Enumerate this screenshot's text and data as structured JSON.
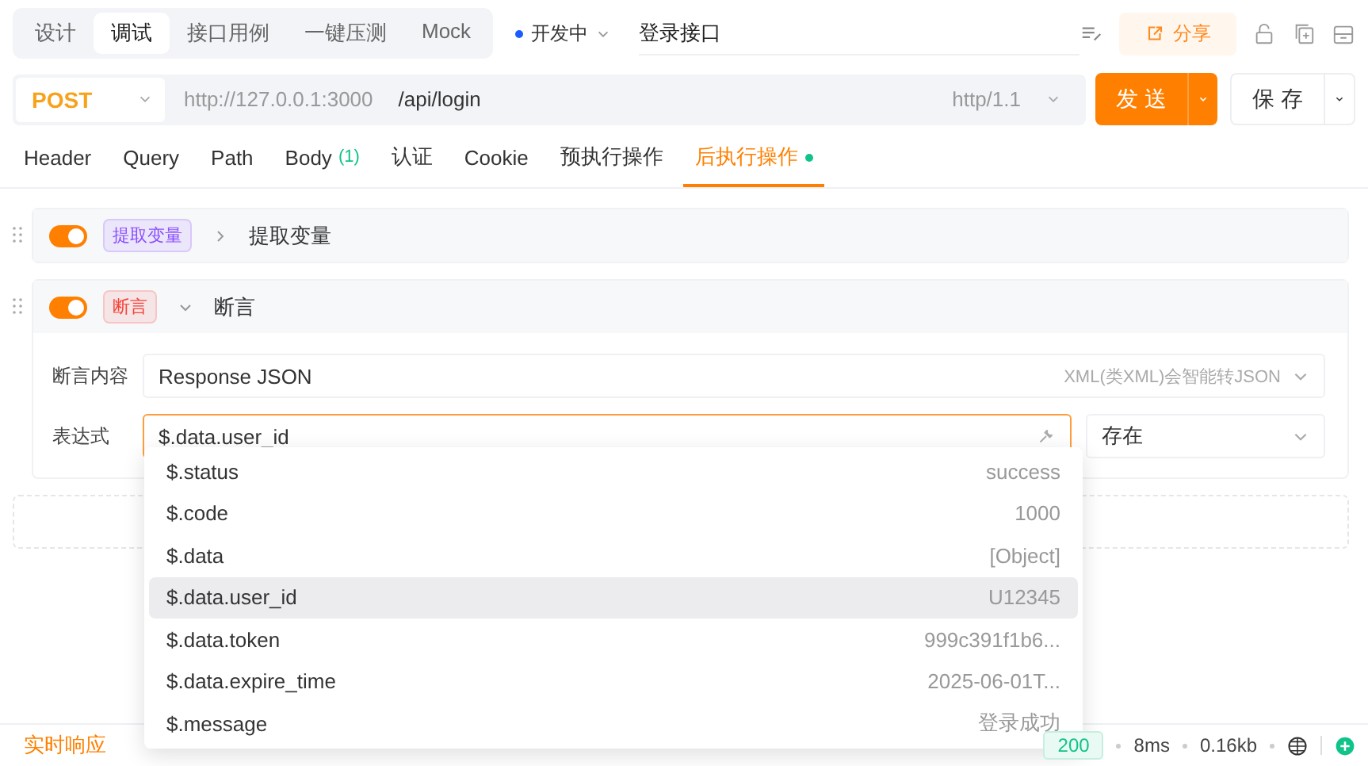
{
  "mode_tabs": [
    {
      "label": "设计",
      "selected": false
    },
    {
      "label": "调试",
      "selected": true
    },
    {
      "label": "接口用例",
      "selected": false
    },
    {
      "label": "一键压测",
      "selected": false
    },
    {
      "label": "Mock",
      "selected": false
    }
  ],
  "status": {
    "label": "开发中",
    "color": "#1a5cff"
  },
  "api_name": "登录接口",
  "share_button": "分享",
  "request": {
    "method": "POST",
    "base_url": "http://127.0.0.1:3000",
    "path": "/api/login",
    "protocol": "http/1.1",
    "send_button": "发 送",
    "save_button": "保 存"
  },
  "request_tabs": [
    {
      "label": "Header",
      "selected": false
    },
    {
      "label": "Query",
      "selected": false
    },
    {
      "label": "Path",
      "selected": false
    },
    {
      "label": "Body",
      "count": "(1)",
      "selected": false
    },
    {
      "label": "认证",
      "selected": false
    },
    {
      "label": "Cookie",
      "selected": false
    },
    {
      "label": "预执行操作",
      "selected": false
    },
    {
      "label": "后执行操作",
      "selected": true,
      "dot": true
    }
  ],
  "operations": [
    {
      "on": true,
      "tag": "提取变量",
      "color": "#8a4dff",
      "expanded": false,
      "title": "提取变量"
    },
    {
      "on": true,
      "tag": "断言",
      "color": "#f5443a",
      "expanded": true,
      "title": "断言",
      "content_label": "断言内容",
      "content_value": "Response JSON",
      "content_hint": "XML(类XML)会智能转JSON",
      "expr_label": "表达式",
      "expr_value": "$.data.user_id",
      "condition": "存在"
    }
  ],
  "suggestions": [
    {
      "path": "$.status",
      "value": "success",
      "selected": false
    },
    {
      "path": "$.code",
      "value": "1000",
      "selected": false
    },
    {
      "path": "$.data",
      "value": "[Object]",
      "selected": false
    },
    {
      "path": "$.data.user_id",
      "value": "U12345",
      "selected": true
    },
    {
      "path": "$.data.token",
      "value": "999c391f1b6...",
      "selected": false
    },
    {
      "path": "$.data.expire_time",
      "value": "2025-06-01T...",
      "selected": false
    },
    {
      "path": "$.message",
      "value": "登录成功",
      "selected": false
    }
  ],
  "response_bar": {
    "tab": "实时响应",
    "status_code": "200",
    "time": "8ms",
    "size": "0.16kb"
  }
}
